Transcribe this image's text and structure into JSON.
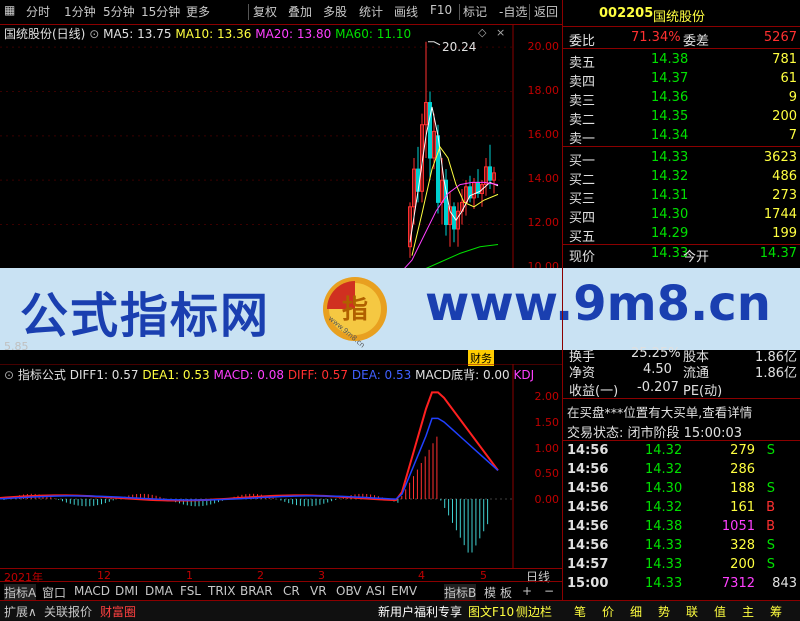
{
  "toolbar": {
    "items": [
      "分时",
      "1分钟",
      "5分钟",
      "15分钟",
      "更多",
      "复权",
      "叠加",
      "多股",
      "统计",
      "画线",
      "F10",
      "标记",
      "-自选",
      "返回"
    ]
  },
  "chart": {
    "title": "国统股份(日线)",
    "ma5": "MA5: 13.75",
    "ma10": "MA10: 13.36",
    "ma20": "MA20: 13.80",
    "ma60": "MA60: 11.10",
    "peak_label": "20.24",
    "y_ticks": [
      "20.00",
      "18.00",
      "16.00",
      "14.00",
      "12.00",
      "10.00"
    ],
    "low_label": "5.85",
    "flags": "财务",
    "colors": {
      "up": "#ff3030",
      "down": "#00d0d0",
      "ma5": "#ffffff",
      "ma10": "#ffff40",
      "ma20": "#ff40ff",
      "ma60": "#00e000"
    }
  },
  "indicator": {
    "name": "指标公式",
    "diff1": "DIFF1: 0.57",
    "dea1": "DEA1: 0.53",
    "macd": "MACD: 0.08",
    "diff": "DIFF: 0.57",
    "dea": "DEA: 0.53",
    "macd_bottom": "MACD底背: 0.00",
    "kdj": "KDJ",
    "y_ticks": [
      "2.00",
      "1.50",
      "1.00",
      "0.50",
      "0.00"
    ]
  },
  "timeline": {
    "labels": [
      "2021年",
      "12",
      "1",
      "2",
      "3",
      "4",
      "5"
    ],
    "period": "日线"
  },
  "bottom_tabs": [
    "指标A",
    "窗口",
    "MACD",
    "DMI",
    "DMA",
    "FSL",
    "TRIX",
    "BRAR",
    "CR",
    "VR",
    "OBV",
    "ASI",
    "EMV",
    "指标B",
    "模",
    "板",
    "+",
    "−"
  ],
  "footer": {
    "left": [
      "扩展∧",
      "关联报价",
      "财富圈"
    ],
    "mid": [
      "新用户福利专享",
      "图文F10",
      "侧边栏"
    ],
    "right": [
      "笔",
      "价",
      "细",
      "势",
      "联",
      "值",
      "主",
      "筹"
    ]
  },
  "quote": {
    "code": "002205",
    "name": "国统股份",
    "webi_label": "委比",
    "webi": "71.34%",
    "weicha_label": "委差",
    "weicha": "5267",
    "asks": [
      {
        "label": "卖五",
        "price": "14.38",
        "vol": "781"
      },
      {
        "label": "卖四",
        "price": "14.37",
        "vol": "61"
      },
      {
        "label": "卖三",
        "price": "14.36",
        "vol": "9"
      },
      {
        "label": "卖二",
        "price": "14.35",
        "vol": "200"
      },
      {
        "label": "卖一",
        "price": "14.34",
        "vol": "7"
      }
    ],
    "bids": [
      {
        "label": "买一",
        "price": "14.33",
        "vol": "3623"
      },
      {
        "label": "买二",
        "price": "14.32",
        "vol": "486"
      },
      {
        "label": "买三",
        "price": "14.31",
        "vol": "273"
      },
      {
        "label": "买四",
        "price": "14.30",
        "vol": "1744"
      },
      {
        "label": "买五",
        "price": "14.29",
        "vol": "199"
      }
    ],
    "xianjia_label": "现价",
    "xianjia": "14.33",
    "jinkai_label": "今开",
    "jinkai": "14.37",
    "huanshou_label": "换手",
    "huanshou": "25.25%",
    "guben_label": "股本",
    "guben": "1.86亿",
    "jingzi_label": "净资",
    "jingzi": "4.50",
    "liutong_label": "流通",
    "liutong": "1.86亿",
    "shouyi_label": "收益(一)",
    "shouyi": "-0.207",
    "pe_label": "PE(动)",
    "notice": "在买盘***位置有大买单,查看详情",
    "status": "交易状态: 闭市阶段 15:00:03",
    "ticks": [
      {
        "t": "14:56",
        "p": "14.32",
        "v": "279",
        "s": "S"
      },
      {
        "t": "14:56",
        "p": "14.32",
        "v": "286",
        "s": ""
      },
      {
        "t": "14:56",
        "p": "14.30",
        "v": "188",
        "s": "S"
      },
      {
        "t": "14:56",
        "p": "14.32",
        "v": "161",
        "s": "B"
      },
      {
        "t": "14:56",
        "p": "14.38",
        "v": "1051",
        "s": "B"
      },
      {
        "t": "14:56",
        "p": "14.33",
        "v": "328",
        "s": "S"
      },
      {
        "t": "14:57",
        "p": "14.33",
        "v": "200",
        "s": "S"
      },
      {
        "t": "15:00",
        "p": "14.33",
        "v": "7312",
        "s": "843"
      }
    ]
  },
  "banner": {
    "left_text": "公式指标网",
    "right_text": "www.9m8.cn",
    "logo_small": "www.9m8.cn"
  }
}
